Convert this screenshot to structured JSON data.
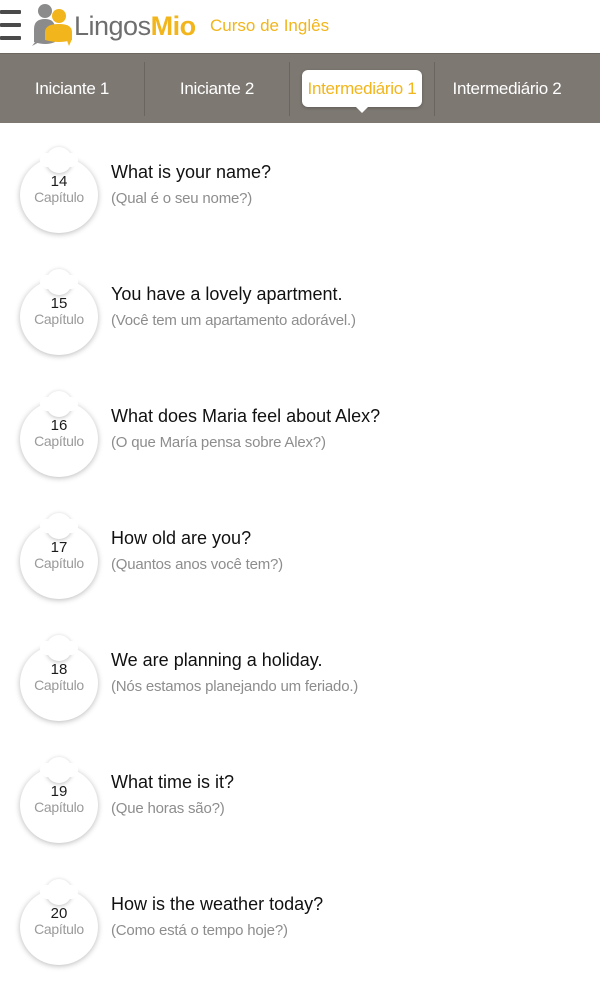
{
  "app": {
    "logo_text_part1": "Lingos",
    "logo_text_part2": "Mio",
    "course_title": "Curso de Inglês",
    "brand_color": "#f2b51b",
    "tabbar_color": "#7d7872"
  },
  "tabs": [
    {
      "label": "Iniciante 1",
      "active": false
    },
    {
      "label": "Iniciante 2",
      "active": false
    },
    {
      "label": "Intermediário 1",
      "active": true
    },
    {
      "label": "Intermediário 2",
      "active": false
    }
  ],
  "chapters": [
    {
      "number": "14",
      "caption": "Capítulo",
      "title": "What is your name?",
      "subtitle": "(Qual é o seu nome?)"
    },
    {
      "number": "15",
      "caption": "Capítulo",
      "title": "You have a lovely apartment.",
      "subtitle": "(Você tem um apartamento adorável.)"
    },
    {
      "number": "16",
      "caption": "Capítulo",
      "title": "What does Maria feel about Alex?",
      "subtitle": "(O que María pensa sobre Alex?)"
    },
    {
      "number": "17",
      "caption": "Capítulo",
      "title": "How old are you?",
      "subtitle": "(Quantos anos você tem?)"
    },
    {
      "number": "18",
      "caption": "Capítulo",
      "title": "We are planning a holiday.",
      "subtitle": "(Nós estamos planejando um feriado.)"
    },
    {
      "number": "19",
      "caption": "Capítulo",
      "title": "What time is it?",
      "subtitle": "(Que horas são?)"
    },
    {
      "number": "20",
      "caption": "Capítulo",
      "title": "How is the weather today?",
      "subtitle": "(Como está o tempo hoje?)"
    }
  ]
}
